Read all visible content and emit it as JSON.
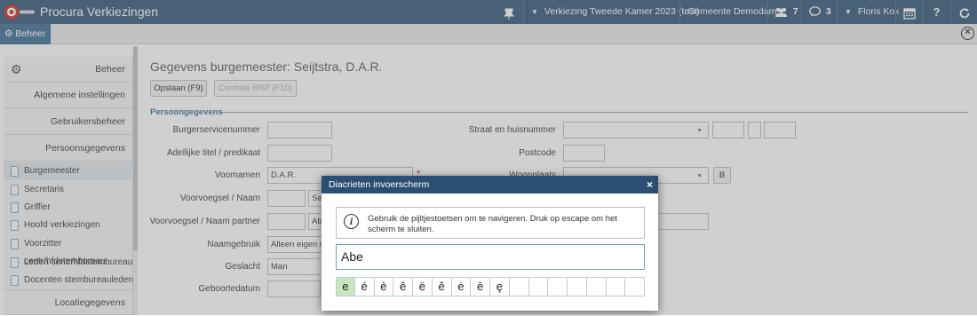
{
  "app": {
    "title": "Procura Verkiezingen",
    "election": "Verkiezing Tweede Kamer 2023 (test)",
    "municipality": "Gemeente Demodam",
    "users_count": "7",
    "messages_count": "3",
    "user": "Floris Kok",
    "icons": {
      "logo": "procura-logo-icon",
      "pin": "pin-icon",
      "users": "users-icon",
      "messages": "chat-bubble-icon",
      "calendar": "calendar-icon",
      "help": "question-icon",
      "refresh": "refresh-icon"
    }
  },
  "subbar": {
    "tab_label": "Beheer"
  },
  "sidebar": {
    "header": "Beheer",
    "groups": [
      "Algemene instellingen",
      "Gebruikersbeheer",
      "Persoonsgegevens"
    ],
    "items": [
      "Burgemeester",
      "Secretaris",
      "Griffier",
      "Hoofd verkiezingen",
      "Voorzitter centr/hfdstembureau",
      "Leden centr/hfdstembureau",
      "Docenten stembureauleden"
    ],
    "footer_group": "Locatiegegevens"
  },
  "page": {
    "title": "Gegevens burgemeester: Seijtstra, D.A.R.",
    "save_button": "Opslaan (F9)",
    "brp_button": "Controle BRP (F10)",
    "section_title": "Persoongegevens"
  },
  "form": {
    "labels": {
      "bsn": "Burgerservicenummer",
      "title": "Adellijke titel / predikaat",
      "firstnames": "Voornamen",
      "prefix_name": "Voorvoegsel / Naam",
      "prefix_partner": "Voorvoegsel / Naam partner",
      "name_usage": "Naamgebruik",
      "gender": "Geslacht",
      "birthdate": "Geboortedatum",
      "street": "Straat en huisnummer",
      "postcode": "Postcode",
      "city": "Woonplaats"
    },
    "values": {
      "firstnames": "D.A.R.",
      "name_usage": "Alleen eigen na",
      "gender": "Man",
      "surname_partial": "Se",
      "partner_partial": "Ab",
      "city_button": "B"
    },
    "required_mark": "*"
  },
  "dialog": {
    "title": "Diacrieten invoerscherm",
    "close_label": "×",
    "info_text": "Gebruik de pijltjestoetsen om te navigeren. Druk op escape om het scherm te sluiten.",
    "input_value": "Abe",
    "characters": [
      "e",
      "é",
      "è",
      "ê",
      "ë",
      "ĕ",
      "ė",
      "ē",
      "ę",
      "",
      "",
      "",
      "",
      "",
      "",
      ""
    ],
    "selected_index": 0
  }
}
